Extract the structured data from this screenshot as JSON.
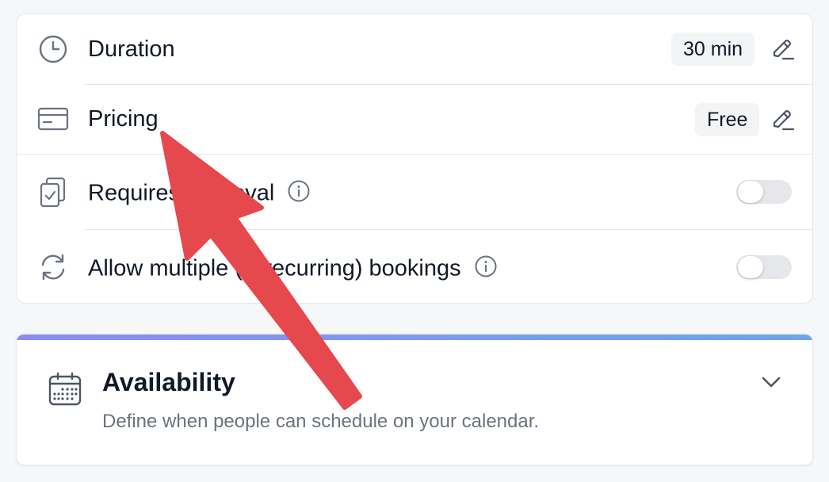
{
  "settings": {
    "duration": {
      "label": "Duration",
      "value": "30 min"
    },
    "pricing": {
      "label": "Pricing",
      "value": "Free"
    },
    "requires_approval": {
      "label": "Requires approval",
      "enabled": false
    },
    "allow_multiple": {
      "label": "Allow multiple (& recurring) bookings",
      "enabled": false
    }
  },
  "availability": {
    "title": "Availability",
    "description": "Define when people can schedule on your calendar."
  },
  "icons": {
    "duration": "clock-icon",
    "pricing": "credit-card-icon",
    "approval": "clipboard-check-icon",
    "multiple": "refresh-icon",
    "edit": "pencil-icon",
    "info": "info-icon",
    "availability": "calendar-icon",
    "expand": "chevron-down-icon"
  },
  "colors": {
    "annotation_arrow": "#e5484d",
    "gradient_start": "#8b8cf2",
    "gradient_end": "#6ea6ee"
  }
}
